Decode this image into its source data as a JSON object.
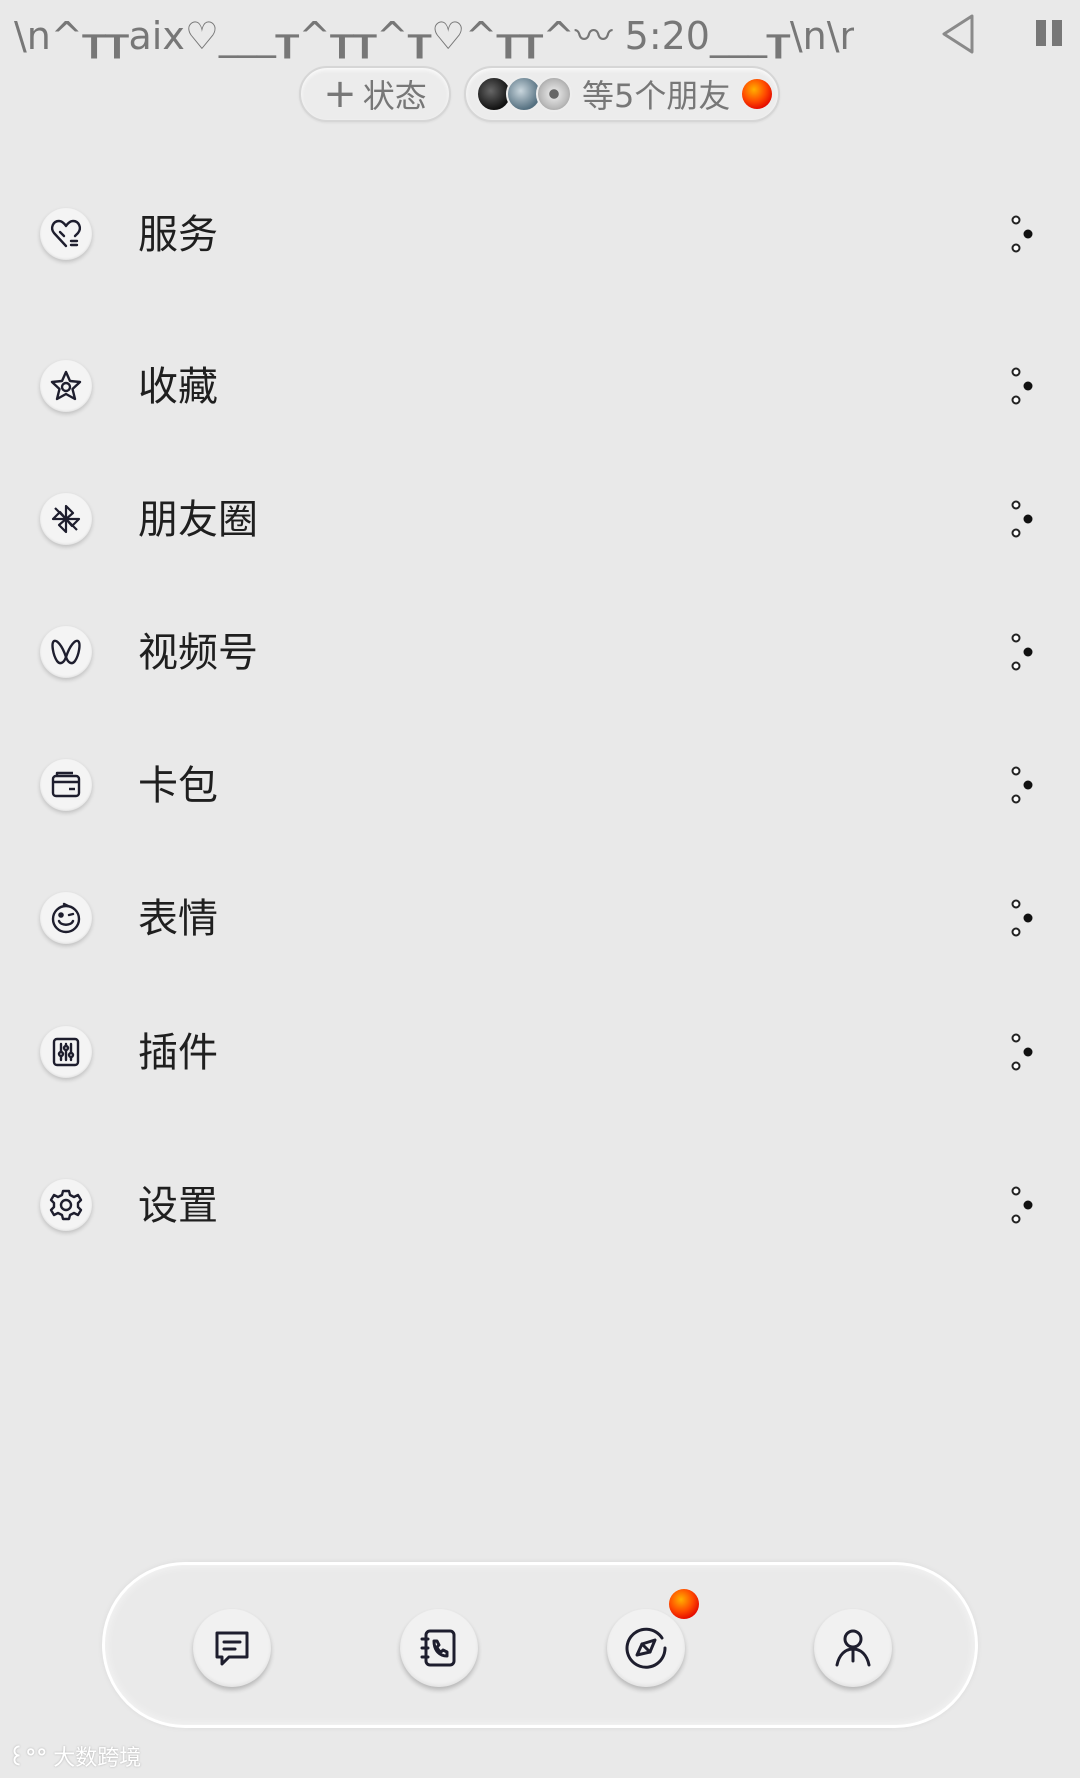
{
  "status_bar": {
    "ticker_text": "\\n^┰┰aix♡___┰^┰┰^┰♡^┰┰^〰 5:20___┰\\n\\n⇆"
  },
  "chips": {
    "status_label": "状态",
    "friends_label": "等5个朋友"
  },
  "menu": {
    "items": [
      {
        "label": "服务",
        "icon": "heart-service-icon"
      },
      {
        "label": "收藏",
        "icon": "star-icon"
      },
      {
        "label": "朋友圈",
        "icon": "pinwheel-icon"
      },
      {
        "label": "视频号",
        "icon": "butterfly-icon"
      },
      {
        "label": "卡包",
        "icon": "wallet-icon"
      },
      {
        "label": "表情",
        "icon": "smiley-icon"
      },
      {
        "label": "插件",
        "icon": "sliders-icon"
      },
      {
        "label": "设置",
        "icon": "gear-icon"
      }
    ]
  },
  "bottom_nav": {
    "items": [
      {
        "name": "chats",
        "icon": "chat-icon"
      },
      {
        "name": "contacts",
        "icon": "contacts-icon"
      },
      {
        "name": "discover",
        "icon": "compass-icon"
      },
      {
        "name": "me",
        "icon": "person-icon"
      }
    ]
  },
  "watermark": {
    "text": "大数跨境"
  },
  "colors": {
    "background": "#e9e9e9",
    "badge_red": "#ff3b00",
    "icon_stroke": "#1e1e2e"
  }
}
